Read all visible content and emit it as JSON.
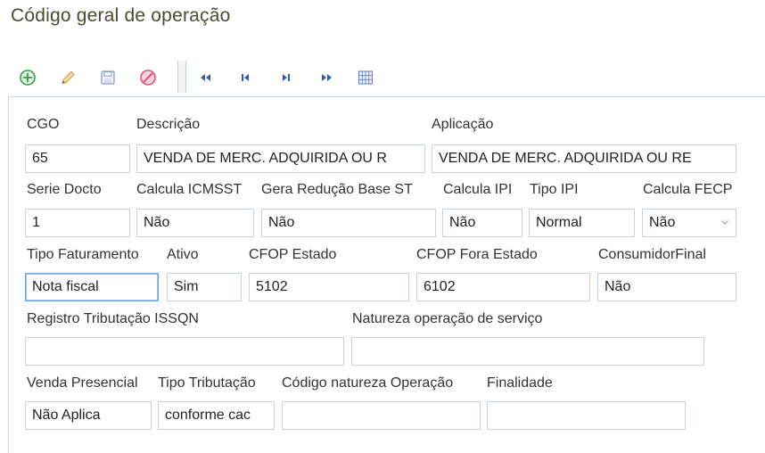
{
  "page": {
    "title": "Código geral de operação"
  },
  "toolbar": {
    "buttons": [
      {
        "name": "add-button",
        "icon": "plus-circle-icon"
      },
      {
        "name": "edit-button",
        "icon": "pencil-icon"
      },
      {
        "name": "save-button",
        "icon": "floppy-disk-icon"
      },
      {
        "name": "cancel-button",
        "icon": "prohibited-icon"
      },
      {
        "name": "first-record-button",
        "icon": "double-chevron-left-icon"
      },
      {
        "name": "previous-record-button",
        "icon": "step-back-icon"
      },
      {
        "name": "next-record-button",
        "icon": "step-forward-icon"
      },
      {
        "name": "last-record-button",
        "icon": "double-chevron-right-icon"
      },
      {
        "name": "grid-view-button",
        "icon": "grid-icon"
      }
    ]
  },
  "form": {
    "cgo": {
      "label": "CGO",
      "value": "65"
    },
    "descricao": {
      "label": "Descrição",
      "value": "VENDA DE MERC. ADQUIRIDA OU R"
    },
    "aplicacao": {
      "label": "Aplicação",
      "value": "VENDA DE MERC. ADQUIRIDA OU RE"
    },
    "serie_docto": {
      "label": "Serie Docto",
      "value": "1"
    },
    "calcula_icmsst": {
      "label": "Calcula ICMSST",
      "value": "Não"
    },
    "gera_reducao_base_st": {
      "label": "Gera Redução Base ST",
      "value": "Não"
    },
    "calcula_ipi": {
      "label": "Calcula IPI",
      "value": "Não"
    },
    "tipo_ipi": {
      "label": "Tipo IPI",
      "value": "Normal"
    },
    "calcula_fecp": {
      "label": "Calcula FECP",
      "value": "Não"
    },
    "tipo_faturamento": {
      "label": "Tipo Faturamento",
      "value": "Nota fiscal"
    },
    "ativo": {
      "label": "Ativo",
      "value": "Sim"
    },
    "cfop_estado": {
      "label": "CFOP Estado",
      "value": "5102"
    },
    "cfop_fora_estado": {
      "label": "CFOP Fora Estado",
      "value": "6102"
    },
    "consumidor_final": {
      "label": "ConsumidorFinal",
      "value": "Não"
    },
    "registro_tributacao_issqn": {
      "label": "Registro Tributação ISSQN",
      "value": ""
    },
    "natureza_operacao_servico": {
      "label": "Natureza operação de serviço",
      "value": ""
    },
    "venda_presencial": {
      "label": "Venda Presencial",
      "value": "Não Aplica"
    },
    "tipo_tributacao": {
      "label": "Tipo Tributação",
      "value": "conforme cac"
    },
    "codigo_natureza_operacao": {
      "label": "Código natureza Operação",
      "value": ""
    },
    "finalidade": {
      "label": "Finalidade",
      "value": ""
    }
  },
  "colors": {
    "title": "#4b4b33",
    "add_icon": "#2ea043",
    "edit_icon": "#c9a24a",
    "save_icon": "#8a9cc8",
    "cancel_icon": "#d9567a",
    "nav_icon": "#2f5fb5",
    "field_border": "#c9d1df",
    "active_field_border": "#6aa6dc"
  }
}
